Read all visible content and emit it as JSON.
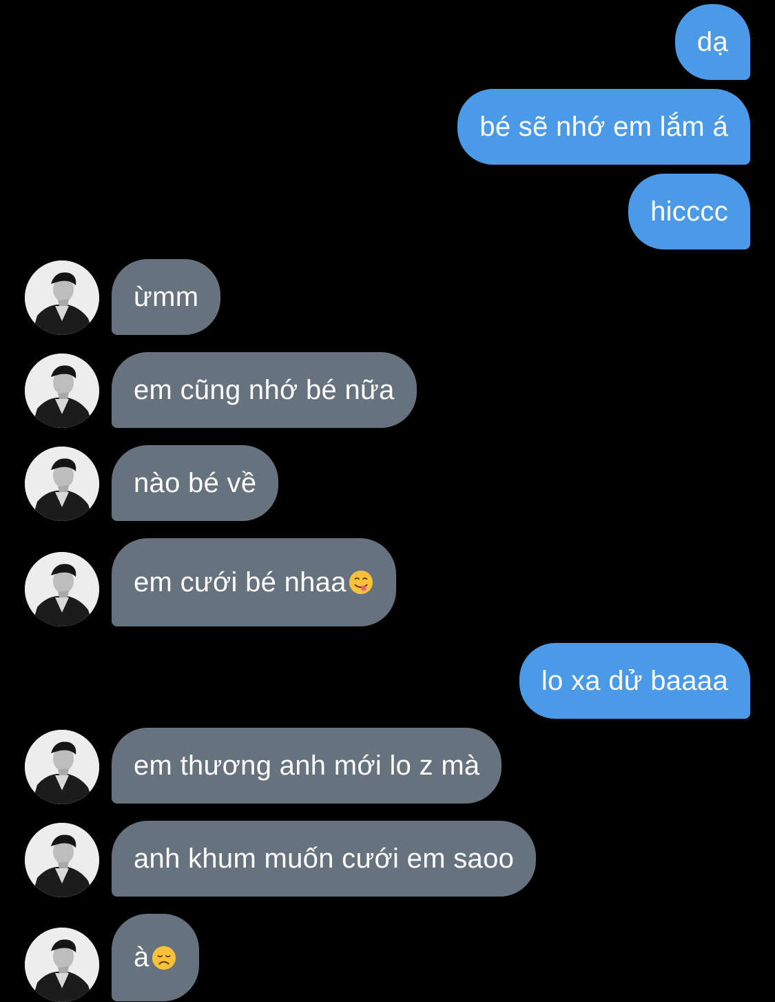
{
  "colors": {
    "background": "#000000",
    "outgoing_bubble": "#4a9ae8",
    "incoming_bubble": "#67727f",
    "text": "#ffffff"
  },
  "messages": [
    {
      "direction": "outgoing",
      "text": "dạ"
    },
    {
      "direction": "outgoing",
      "text": "bé sẽ nhớ em lắm á"
    },
    {
      "direction": "outgoing",
      "text": "hicccc"
    },
    {
      "direction": "incoming",
      "text": "ừmm",
      "avatar": "profile-photo"
    },
    {
      "direction": "incoming",
      "text": "em cũng nhớ bé nữa",
      "avatar": "profile-photo"
    },
    {
      "direction": "incoming",
      "text": "nào bé về",
      "avatar": "profile-photo"
    },
    {
      "direction": "incoming",
      "text": "em cưới bé nhaa",
      "emoji": "yum-face-emoji",
      "avatar": "profile-photo"
    },
    {
      "direction": "outgoing",
      "text": "lo xa dử baaaa"
    },
    {
      "direction": "incoming",
      "text": "em thương anh mới lo z mà",
      "avatar": "profile-photo"
    },
    {
      "direction": "incoming",
      "text": "anh khum muốn cưới em saoo",
      "avatar": "profile-photo"
    },
    {
      "direction": "incoming",
      "text": "à",
      "emoji": "disappointed-face-emoji",
      "avatar": "profile-photo"
    }
  ]
}
